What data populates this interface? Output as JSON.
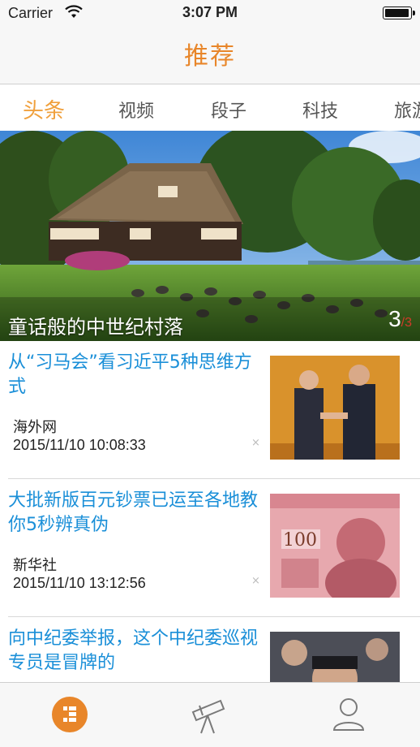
{
  "status_bar": {
    "carrier": "Carrier",
    "time": "3:07 PM",
    "battery_level": 1.0
  },
  "nav": {
    "title": "推荐"
  },
  "tabs": [
    {
      "label": "头条",
      "active": true
    },
    {
      "label": "视频",
      "active": false
    },
    {
      "label": "段子",
      "active": false
    },
    {
      "label": "科技",
      "active": false
    },
    {
      "label": "旅游",
      "active": false
    }
  ],
  "hero": {
    "caption": "童话般的中世纪村落",
    "page_current": "3",
    "page_total": "/3"
  },
  "news": [
    {
      "title": "从“习马会”看习近平5种思维方式",
      "source": "海外网",
      "time": "2015/11/10 10:08:33",
      "close": "×",
      "thumb_icon": "handshake-photo"
    },
    {
      "title": "大批新版百元钞票已运至各地教你5秒辨真伪",
      "source": "新华社",
      "time": "2015/11/10 13:12:56",
      "close": "×",
      "thumb_icon": "banknote-photo"
    },
    {
      "title": "向中纪委举报，这个中纪委巡视专员是冒牌的",
      "source": "",
      "time": "",
      "close": "",
      "thumb_icon": "portrait-photo"
    }
  ],
  "tabbar": {
    "items": [
      {
        "icon": "recommend-icon",
        "active": true
      },
      {
        "icon": "telescope-icon",
        "active": false
      },
      {
        "icon": "person-icon",
        "active": false
      }
    ],
    "accent": "#e8862a"
  },
  "colors": {
    "accent": "#e8862a",
    "tab_active": "#f0a03c",
    "news_title": "#1a8fd8"
  }
}
